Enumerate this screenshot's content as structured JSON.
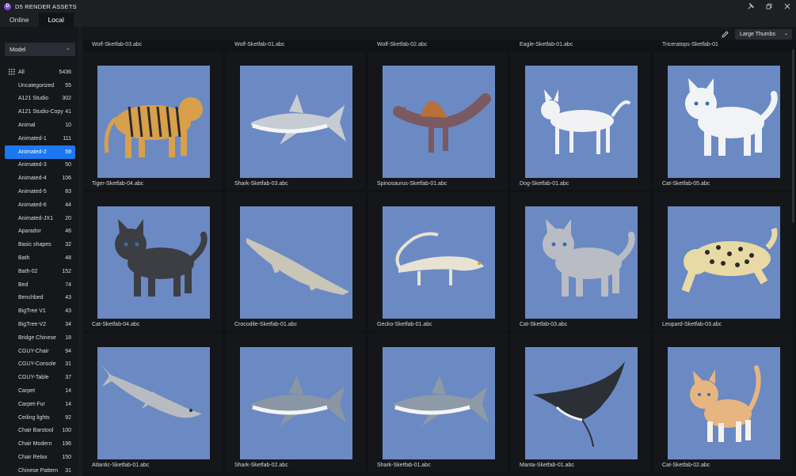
{
  "app": {
    "title": "D5 RENDER ASSETS",
    "logo_letter": "D"
  },
  "tabs": [
    {
      "label": "Online"
    },
    {
      "label": "Local"
    }
  ],
  "filter": {
    "selected": "Model"
  },
  "view": {
    "selected": "Large Thumbs"
  },
  "categories": [
    {
      "label": "All",
      "count": "5436"
    },
    {
      "label": "Uncategorized",
      "count": "55"
    },
    {
      "label": "A121 Studio",
      "count": "302"
    },
    {
      "label": "A121 Studio-Copy",
      "count": "41"
    },
    {
      "label": "Animal",
      "count": "10"
    },
    {
      "label": "Animated-1",
      "count": "111"
    },
    {
      "label": "Animated-2",
      "count": "59"
    },
    {
      "label": "Animated-3",
      "count": "50"
    },
    {
      "label": "Animated-4",
      "count": "106"
    },
    {
      "label": "Animated-5",
      "count": "83"
    },
    {
      "label": "Animated-6",
      "count": "44"
    },
    {
      "label": "Animated-JX1",
      "count": "20"
    },
    {
      "label": "Aparador",
      "count": "46"
    },
    {
      "label": "Basic shapes",
      "count": "32"
    },
    {
      "label": "Bath",
      "count": "48"
    },
    {
      "label": "Bath-02",
      "count": "152"
    },
    {
      "label": "Bed",
      "count": "74"
    },
    {
      "label": "Benchbed",
      "count": "43"
    },
    {
      "label": "BigTree V1",
      "count": "43"
    },
    {
      "label": "BigTree-V2",
      "count": "34"
    },
    {
      "label": "Bridge Chinese",
      "count": "18"
    },
    {
      "label": "CGUY-Chair",
      "count": "94"
    },
    {
      "label": "CGUY-Console",
      "count": "31"
    },
    {
      "label": "CGUY-Table",
      "count": "37"
    },
    {
      "label": "Carpet",
      "count": "14"
    },
    {
      "label": "Carpet-Fur",
      "count": "14"
    },
    {
      "label": "Ceiling lights",
      "count": "92"
    },
    {
      "label": "Chair Barstool",
      "count": "100"
    },
    {
      "label": "Chair Modern",
      "count": "196"
    },
    {
      "label": "Chair Relax",
      "count": "150"
    },
    {
      "label": "Chinese Pattern",
      "count": "31"
    }
  ],
  "top_row_labels": [
    "Wolf-Sketfab-03.abc",
    "Wolf-Sketfab-01.abc",
    "Wolf-Sketfab-02.abc",
    "Eagle-Sketfab-01.abc",
    "Triceratops-Sketfab-01"
  ],
  "assets": [
    {
      "name": "Tiger-Sketfab-04.abc",
      "subject": "tiger",
      "color": "#d8a04a"
    },
    {
      "name": "Shark-Sketfab-03.abc",
      "subject": "shark",
      "color": "#c7ccd2"
    },
    {
      "name": "Spinosaurus-Sketfab-01.abc",
      "subject": "spinosaurus",
      "color": "#7a5a60"
    },
    {
      "name": "Dog-Sketfab-01.abc",
      "subject": "dog",
      "color": "#f2f2f4"
    },
    {
      "name": "Cat-Sketfab-05.abc",
      "subject": "cat",
      "color": "#f1f3f6"
    },
    {
      "name": "Cat-Sketfab-04.abc",
      "subject": "cat",
      "color": "#3c3e44"
    },
    {
      "name": "Crocodile-Sketfab-01.abc",
      "subject": "crocodile",
      "color": "#c9c6b8"
    },
    {
      "name": "Gecko-Sketfab-01.abc",
      "subject": "gecko",
      "color": "#e7e2d2"
    },
    {
      "name": "Cat-Sketfab-03.abc",
      "subject": "cat",
      "color": "#b9bcc4"
    },
    {
      "name": "Leopard-Sketfab-03.abc",
      "subject": "leopard",
      "color": "#e9d9a4"
    },
    {
      "name": "Atlantic-Sketfab-01.abc",
      "subject": "sturgeon",
      "color": "#b8bcc0"
    },
    {
      "name": "Shark-Sketfab-02.abc",
      "subject": "shark",
      "color": "#8b96a4"
    },
    {
      "name": "Shark-Sketfab-01.abc",
      "subject": "shark",
      "color": "#8e9aa8"
    },
    {
      "name": "Manta-Sketfab-01.abc",
      "subject": "manta",
      "color": "#2c2f36"
    },
    {
      "name": "Cat-Sketfab-02.abc",
      "subject": "kitten",
      "color": "#e6b580"
    }
  ],
  "colors": {
    "accent": "#1b78f2",
    "thumb_bg": "#6b8ac4",
    "panel": "#15171b"
  }
}
